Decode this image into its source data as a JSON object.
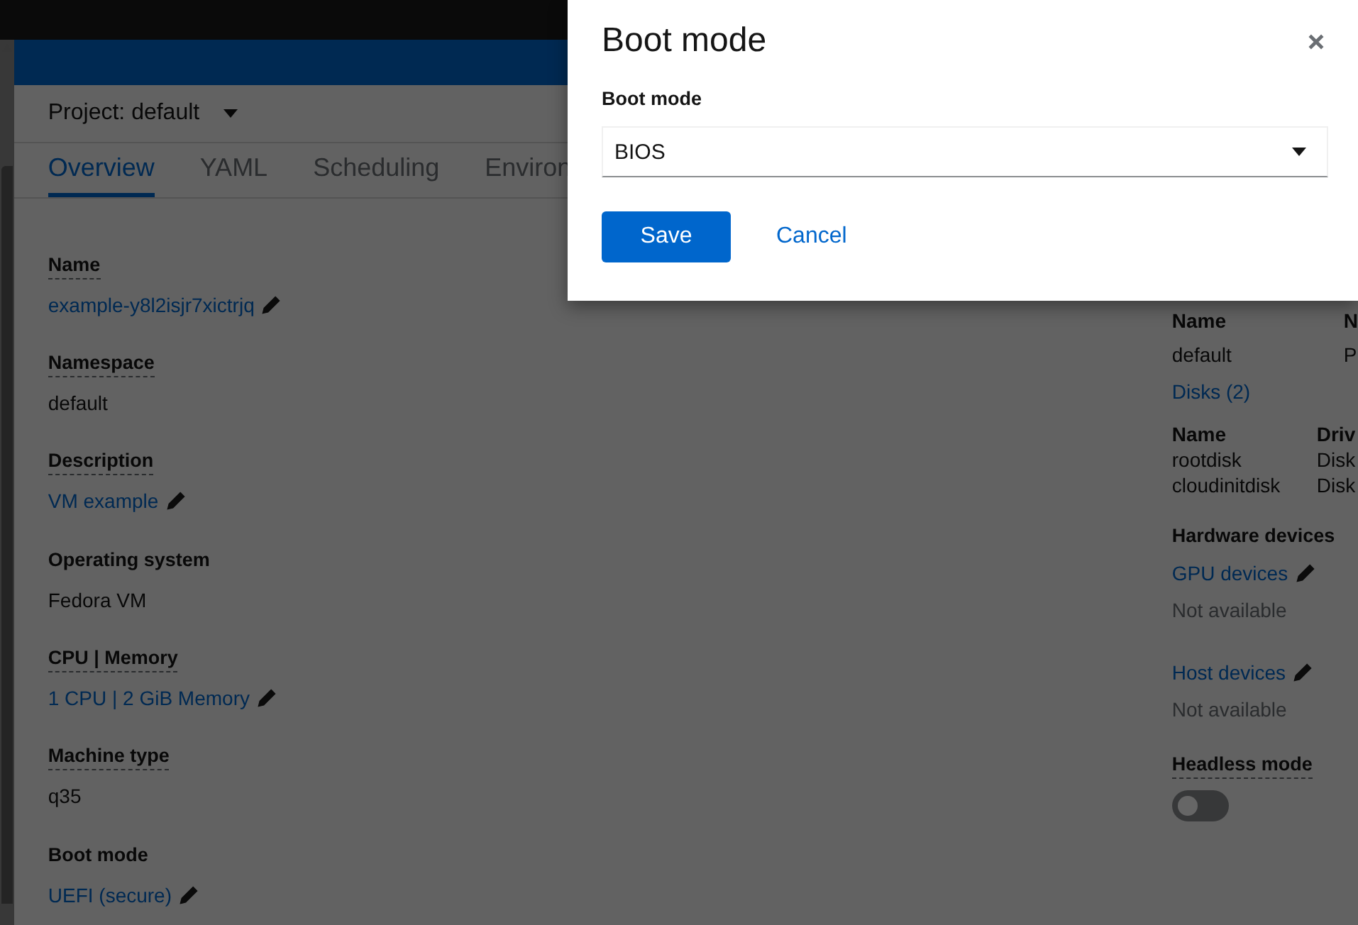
{
  "project": {
    "label": "Project: default"
  },
  "tabs": [
    {
      "label": "Overview",
      "selected": true
    },
    {
      "label": "YAML",
      "selected": false
    },
    {
      "label": "Scheduling",
      "selected": false
    },
    {
      "label": "Environ",
      "selected": false
    }
  ],
  "details": [
    {
      "label": "Name",
      "has_help": true,
      "value": "example-y8l2isjr7xictrjq",
      "kind": "link",
      "editable": true
    },
    {
      "label": "Namespace",
      "has_help": true,
      "value": "default",
      "kind": "text",
      "editable": false
    },
    {
      "label": "Description",
      "has_help": true,
      "value": "VM example",
      "kind": "link",
      "editable": true
    },
    {
      "label": "Operating system",
      "has_help": false,
      "value": "Fedora VM",
      "kind": "text",
      "editable": false
    },
    {
      "label": "CPU | Memory",
      "has_help": true,
      "value": "1 CPU | 2 GiB Memory",
      "kind": "link",
      "editable": true
    },
    {
      "label": "Machine type",
      "has_help": true,
      "value": "q35",
      "kind": "text",
      "editable": false
    },
    {
      "label": "Boot mode",
      "has_help": false,
      "value": "UEFI (secure)",
      "kind": "link",
      "editable": true
    }
  ],
  "network_table": {
    "columns": [
      "Name",
      "N"
    ],
    "rows": [
      [
        "default",
        "P"
      ]
    ]
  },
  "disks": {
    "title": "Disks (2)",
    "columns": [
      "Name",
      "Driv"
    ],
    "rows": [
      [
        "rootdisk",
        "Disk"
      ],
      [
        "cloudinitdisk",
        "Disk"
      ]
    ]
  },
  "hardware": {
    "title": "Hardware devices",
    "groups": [
      {
        "label": "GPU devices",
        "value": "Not available"
      },
      {
        "label": "Host devices",
        "value": "Not available"
      }
    ]
  },
  "headless_mode": {
    "label": "Headless mode",
    "on": false
  },
  "modal": {
    "title": "Boot mode",
    "field_label": "Boot mode",
    "select_value": "BIOS",
    "buttons": [
      {
        "label": "Save",
        "kind": "primary"
      },
      {
        "label": "Cancel",
        "kind": "link"
      }
    ]
  }
}
